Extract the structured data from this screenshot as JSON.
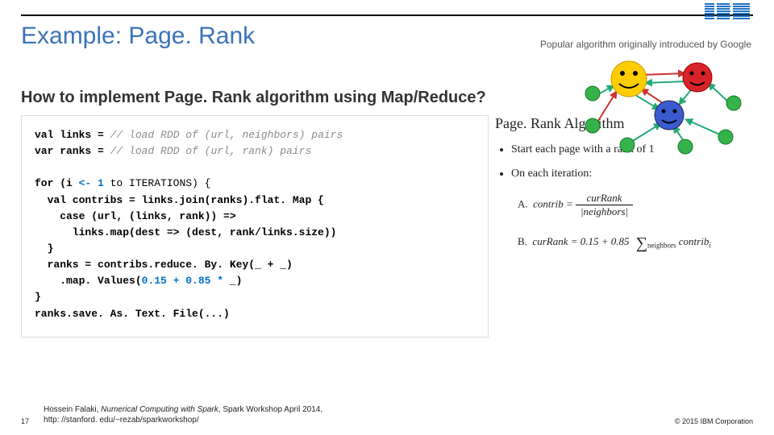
{
  "header": {
    "title": "Example: Page. Rank",
    "caption": "Popular algorithm originally introduced by Google"
  },
  "subtitle": "How to implement Page. Rank algorithm using Map/Reduce?",
  "code": {
    "l1a": "val links = ",
    "l1b": "// load RDD of (url, neighbors) pairs",
    "l2a": "var ranks = ",
    "l2b": "// load RDD of (url, rank) pairs",
    "l3a": "for (i ",
    "l3arrow": "<- 1",
    "l3b": " to ITERATIONS) {",
    "l4": "  val contribs = links.join(ranks).flat. Map {",
    "l5": "    case (url, (links, rank)) =>",
    "l6": "      links.map(dest => (dest, rank/links.size))",
    "l7": "  }",
    "l8": "  ranks = contribs.reduce. By. Key(_ + _)",
    "l9a": "    .map. Values(",
    "l9b": "0.15 + 0.85 * ",
    "l9c": "_)",
    "l10": "}",
    "l11": "ranks.save. As. Text. File(...)"
  },
  "algo": {
    "title": "Page. Rank Algorithm",
    "bullet1": "Start each page with a rank of 1",
    "bullet2": "On each iteration:",
    "stepA_label": "A.",
    "stepA_lhs": "contrib =",
    "stepA_num": "curRank",
    "stepA_den": "|neighbors|",
    "stepB_label": "B.",
    "stepB_lhs": "curRank = 0.15 + 0.85",
    "stepB_sub": "neighbors",
    "stepB_rhs": "contrib",
    "stepB_i": "i"
  },
  "citation": {
    "author": "Hossein Falaki, ",
    "work": "Numerical Computing with Spark",
    "rest": ", Spark Workshop April 2014,",
    "url": "http: //stanford. edu/~rezab/sparkworkshop/"
  },
  "page": "17",
  "copyright": "© 2015 IBM Corporation",
  "logo_text": "IBM"
}
